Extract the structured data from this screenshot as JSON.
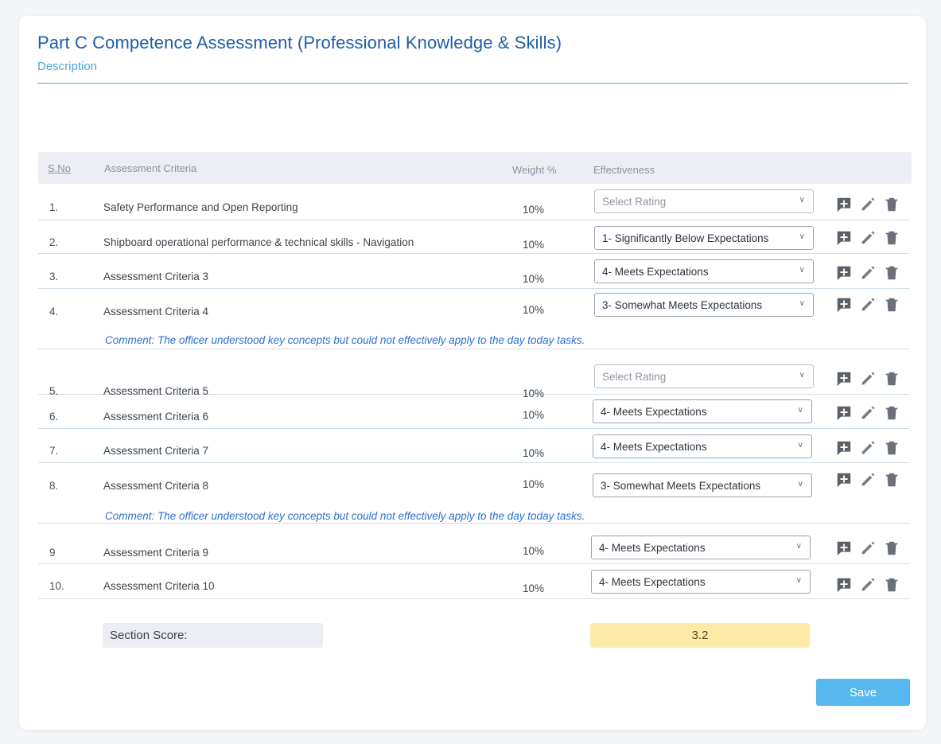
{
  "header": {
    "title": "Part C Competence Assessment (Professional Knowledge & Skills)",
    "description_link": "Description"
  },
  "table": {
    "columns": {
      "sno": "S.No",
      "criteria": "Assessment Criteria",
      "weight": "Weight %",
      "effectiveness": "Effectiveness"
    },
    "rows": [
      {
        "sno": "1.",
        "criteria": "Safety Performance and Open Reporting",
        "weight": "10%",
        "rating": "Select Rating",
        "placeholder": true,
        "comment": ""
      },
      {
        "sno": "2.",
        "criteria": "Shipboard operational performance & technical skills - Navigation",
        "weight": "10%",
        "rating": "1- Significantly Below Expectations",
        "placeholder": false,
        "comment": ""
      },
      {
        "sno": "3.",
        "criteria": "Assessment Criteria 3",
        "weight": "10%",
        "rating": "4- Meets Expectations",
        "placeholder": false,
        "comment": ""
      },
      {
        "sno": "4.",
        "criteria": "Assessment Criteria 4",
        "weight": "10%",
        "rating": "3- Somewhat Meets Expectations",
        "placeholder": false,
        "comment": "Comment: The officer understood key concepts but could not effectively apply to the day today tasks."
      },
      {
        "sno": "5.",
        "criteria": "Assessment Criteria 5",
        "weight": "10%",
        "rating": "Select Rating",
        "placeholder": true,
        "comment": ""
      },
      {
        "sno": "6.",
        "criteria": "Assessment Criteria 6",
        "weight": "10%",
        "rating": "4- Meets Expectations",
        "placeholder": false,
        "comment": ""
      },
      {
        "sno": "7.",
        "criteria": "Assessment Criteria 7",
        "weight": "10%",
        "rating": "4- Meets Expectations",
        "placeholder": false,
        "comment": ""
      },
      {
        "sno": "8.",
        "criteria": "Assessment Criteria 8",
        "weight": "10%",
        "rating": "3- Somewhat Meets Expectations",
        "placeholder": false,
        "comment": "Comment: The officer understood key concepts but could not effectively apply to the day today tasks."
      },
      {
        "sno": "9",
        "criteria": "Assessment Criteria 9",
        "weight": "10%",
        "rating": "4- Meets Expectations",
        "placeholder": false,
        "comment": ""
      },
      {
        "sno": "10.",
        "criteria": "Assessment Criteria 10",
        "weight": "10%",
        "rating": "4- Meets Expectations",
        "placeholder": false,
        "comment": ""
      }
    ],
    "row_actions": [
      "add-comment-icon",
      "edit-icon",
      "delete-icon"
    ]
  },
  "section_score": {
    "label": "Section Score:",
    "value": "3.2"
  },
  "save_label": "Save",
  "colors": {
    "title": "#1f5ea8",
    "link": "#4aa8e0",
    "comment": "#2e6fd1",
    "score_bg": "#fdeaa8",
    "save_bg": "#56b8ef"
  }
}
